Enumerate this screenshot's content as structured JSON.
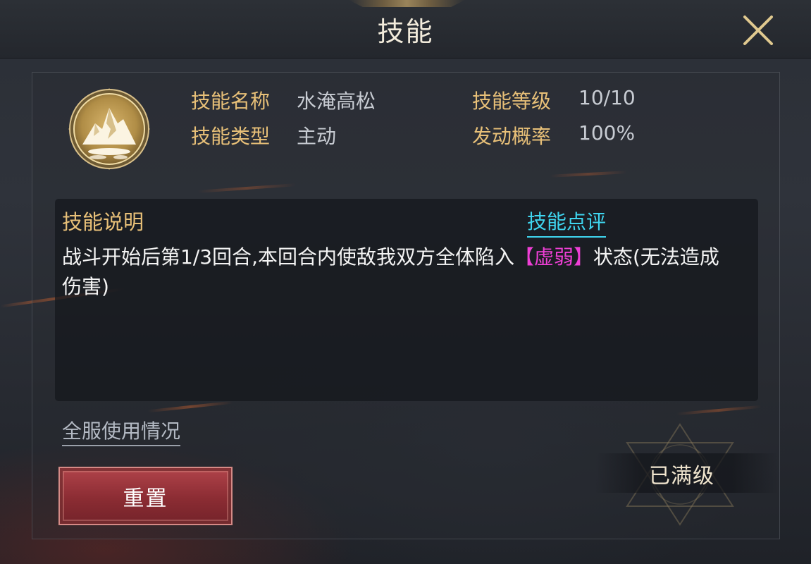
{
  "header": {
    "title": "技能"
  },
  "skill": {
    "icon": "snow-mountain-icon",
    "name_label": "技能名称",
    "name_value": "水淹高松",
    "level_label": "技能等级",
    "level_value": "10/10",
    "type_label": "技能类型",
    "type_value": "主动",
    "chance_label": "发动概率",
    "chance_value": "100%"
  },
  "description": {
    "label": "技能说明",
    "review_link": "技能点评",
    "text_before": "战斗开始后第1/3回合,本回合内使敌我双方全体陷入",
    "debuff": "【虚弱】",
    "text_after": "状态(无法造成伤害)"
  },
  "links": {
    "server_usage": "全服使用情况"
  },
  "buttons": {
    "reset": "重置",
    "max_level": "已满级"
  },
  "colors": {
    "label_gold": "#e8c078",
    "link_cyan": "#3fd6f0",
    "debuff_magenta": "#ef3fd6",
    "button_red": "#8b2c33"
  }
}
